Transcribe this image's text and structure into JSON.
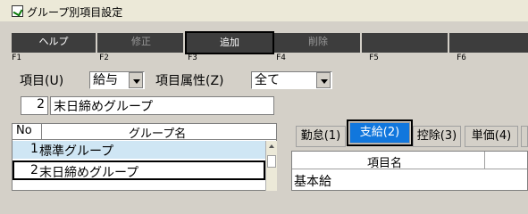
{
  "window": {
    "title": "グループ別項目設定"
  },
  "fkeys": [
    {
      "label": "ヘルプ",
      "key": "F1",
      "enabled": true
    },
    {
      "label": "修正",
      "key": "F2",
      "enabled": false
    },
    {
      "label": "追加",
      "key": "F3",
      "enabled": true
    },
    {
      "label": "削除",
      "key": "F4",
      "enabled": false
    },
    {
      "label": "",
      "key": "F5",
      "enabled": false
    },
    {
      "label": "",
      "key": "F6",
      "enabled": false
    }
  ],
  "filters": {
    "item_label": "項目(U)",
    "item_value": "給与",
    "attr_label": "項目属性(Z)",
    "attr_value": "全て"
  },
  "current_group": {
    "no": "2",
    "name": "末日締めグループ"
  },
  "group_list": {
    "col_no": "No",
    "col_name": "グループ名",
    "rows": [
      {
        "no": "1",
        "name": "標準グループ"
      },
      {
        "no": "2",
        "name": "末日締めグループ"
      }
    ]
  },
  "tabs": [
    "勤怠(1)",
    "支給(2)",
    "控除(3)",
    "単価(4)"
  ],
  "active_tab": "支給(2)",
  "item_grid": {
    "col_name": "項目名",
    "rows": [
      "基本給"
    ]
  },
  "colors": {
    "selected_row": "#cfe6f4",
    "active_tab": "#1177dd",
    "toolbar": "#3d3d3d"
  }
}
